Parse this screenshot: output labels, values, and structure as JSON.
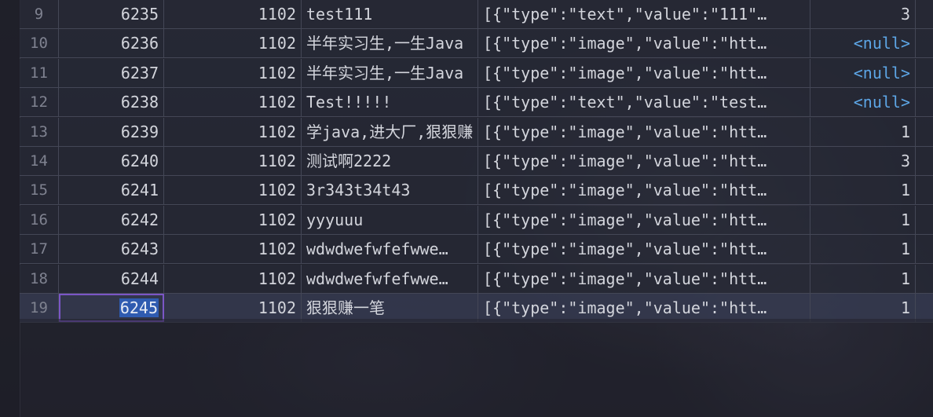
{
  "rows": [
    {
      "rn": "9",
      "id": "6235",
      "uid": "1102",
      "title": "test111",
      "json": "[{\"type\":\"text\",\"value\":\"111\"…",
      "num": "3",
      "num_null": false
    },
    {
      "rn": "10",
      "id": "6236",
      "uid": "1102",
      "title": "半年实习生,一生Java",
      "json": "[{\"type\":\"image\",\"value\":\"htt…",
      "num": "<null>",
      "num_null": true
    },
    {
      "rn": "11",
      "id": "6237",
      "uid": "1102",
      "title": "半年实习生,一生Java",
      "json": "[{\"type\":\"image\",\"value\":\"htt…",
      "num": "<null>",
      "num_null": true
    },
    {
      "rn": "12",
      "id": "6238",
      "uid": "1102",
      "title": "Test!!!!!",
      "json": "[{\"type\":\"text\",\"value\":\"test…",
      "num": "<null>",
      "num_null": true
    },
    {
      "rn": "13",
      "id": "6239",
      "uid": "1102",
      "title": "学java,进大厂,狠狠赚",
      "json": "[{\"type\":\"image\",\"value\":\"htt…",
      "num": "1",
      "num_null": false
    },
    {
      "rn": "14",
      "id": "6240",
      "uid": "1102",
      "title": "测试啊2222",
      "json": "[{\"type\":\"image\",\"value\":\"htt…",
      "num": "3",
      "num_null": false
    },
    {
      "rn": "15",
      "id": "6241",
      "uid": "1102",
      "title": "3r343t34t43",
      "json": "[{\"type\":\"image\",\"value\":\"htt…",
      "num": "1",
      "num_null": false
    },
    {
      "rn": "16",
      "id": "6242",
      "uid": "1102",
      "title": "yyyuuu",
      "json": "[{\"type\":\"image\",\"value\":\"htt…",
      "num": "1",
      "num_null": false
    },
    {
      "rn": "17",
      "id": "6243",
      "uid": "1102",
      "title": "wdwdwefwfefwwe…",
      "json": "[{\"type\":\"image\",\"value\":\"htt…",
      "num": "1",
      "num_null": false
    },
    {
      "rn": "18",
      "id": "6244",
      "uid": "1102",
      "title": "wdwdwefwfefwwe…",
      "json": "[{\"type\":\"image\",\"value\":\"htt…",
      "num": "1",
      "num_null": false
    },
    {
      "rn": "19",
      "id": "6245",
      "uid": "1102",
      "title": "狠狠赚一笔",
      "json": "[{\"type\":\"image\",\"value\":\"htt…",
      "num": "1",
      "num_null": false
    }
  ],
  "selected_row_index": 10,
  "colors": {
    "null_value": "#5da6e6",
    "selection_border": "#7b56c6",
    "selection_fill": "#2f5bb0"
  }
}
